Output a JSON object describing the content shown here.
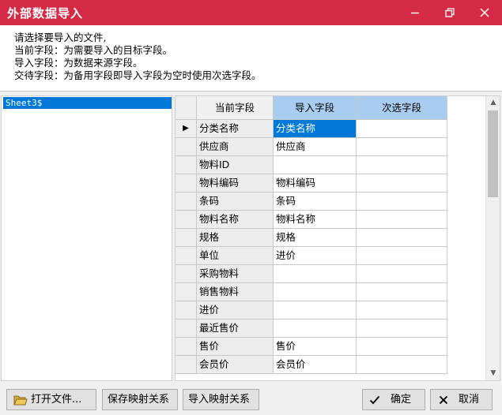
{
  "window": {
    "title": "外部数据导入"
  },
  "instructions": [
    "请选择要导入的文件,",
    "当前字段：为需要导入的目标字段。",
    "导入字段：为数据来源字段。",
    "交待字段：为备用字段即导入字段为空时使用次选字段。"
  ],
  "sheets": [
    "Sheet3$"
  ],
  "grid": {
    "headers": [
      "当前字段",
      "导入字段",
      "次选字段"
    ],
    "rows": [
      {
        "current": "分类名称",
        "import": "分类名称",
        "alt": ""
      },
      {
        "current": "供应商",
        "import": "供应商",
        "alt": ""
      },
      {
        "current": "物料ID",
        "import": "",
        "alt": ""
      },
      {
        "current": "物料编码",
        "import": "物料编码",
        "alt": ""
      },
      {
        "current": "条码",
        "import": "条码",
        "alt": ""
      },
      {
        "current": "物料名称",
        "import": "物料名称",
        "alt": ""
      },
      {
        "current": "规格",
        "import": "规格",
        "alt": ""
      },
      {
        "current": "单位",
        "import": "进价",
        "alt": ""
      },
      {
        "current": "采购物料",
        "import": "",
        "alt": ""
      },
      {
        "current": "销售物料",
        "import": "",
        "alt": ""
      },
      {
        "current": "进价",
        "import": "",
        "alt": ""
      },
      {
        "current": "最近售价",
        "import": "",
        "alt": ""
      },
      {
        "current": "售价",
        "import": "售价",
        "alt": ""
      },
      {
        "current": "会员价",
        "import": "会员价",
        "alt": ""
      }
    ],
    "current_row_marker": "▶"
  },
  "buttons": {
    "open_file": "打开文件...",
    "save_mapping": "保存映射关系",
    "import_mapping": "导入映射关系",
    "ok": "确定",
    "cancel": "取消"
  },
  "colors": {
    "titlebar": "#d42a45",
    "selection": "#0078d7",
    "header_highlight": "#a8cdf0"
  }
}
